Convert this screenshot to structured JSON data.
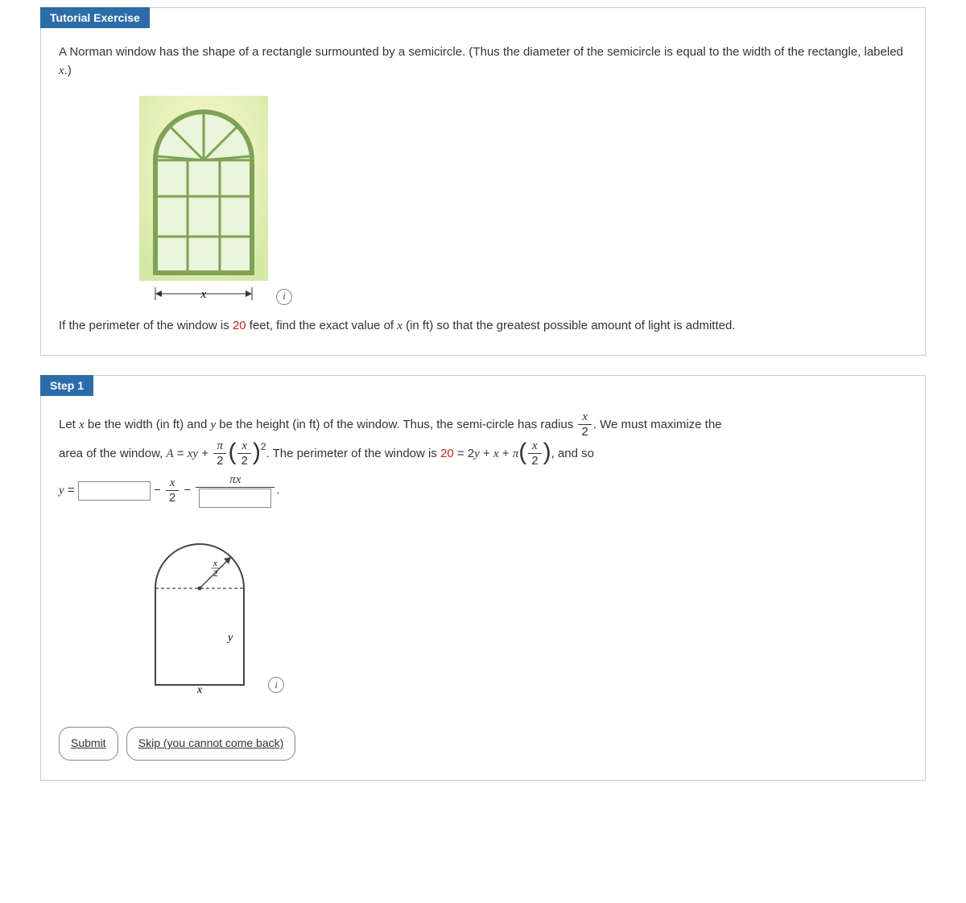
{
  "tutorial": {
    "header": "Tutorial Exercise",
    "prompt_a": "A Norman window has the shape of a rectangle surmounted by a semicircle. (Thus the diameter of the semicircle is equal to the width of the rectangle, labeled ",
    "prompt_b_var": "x",
    "prompt_c": ".)",
    "perimeter_a": "If the perimeter of the window is ",
    "perimeter_num": "20",
    "perimeter_b": " feet, find the exact value of ",
    "perimeter_var": "x",
    "perimeter_c": " (in ft) so that the greatest possible amount of light is admitted.",
    "fig_x": "x"
  },
  "step1": {
    "header": "Step 1",
    "t1": "Let ",
    "var_x": "x",
    "t2": " be the width (in ft) and ",
    "var_y": "y",
    "t3": " be the height (in ft) of the window. Thus, the semi-circle has radius ",
    "rad_num": "x",
    "rad_den": "2",
    "t4": ". We must maximize the",
    "t5": "area of the window, ",
    "area_lhs": "A",
    "eq": " = ",
    "xy": "xy",
    "plus": " + ",
    "pi": "π",
    "two": "2",
    "x": "x",
    "exp2": "2",
    "t6": ". The perimeter of the window is ",
    "perim_val": "20",
    "perim_eq1": " = 2",
    "perim_y": "y",
    "perim_eq2": " + ",
    "perim_x": "x",
    "t7": ", and so",
    "y_eq": "y",
    "eq2": " = ",
    "minus": " − ",
    "half_num": "x",
    "half_den": "2",
    "pix_num": "πx",
    "period": ".",
    "diag_x2": "x",
    "diag_y": "y",
    "diag_r_num": "x",
    "diag_r_den": "2"
  },
  "buttons": {
    "submit": "Submit",
    "skip": "Skip (you cannot come back)"
  }
}
